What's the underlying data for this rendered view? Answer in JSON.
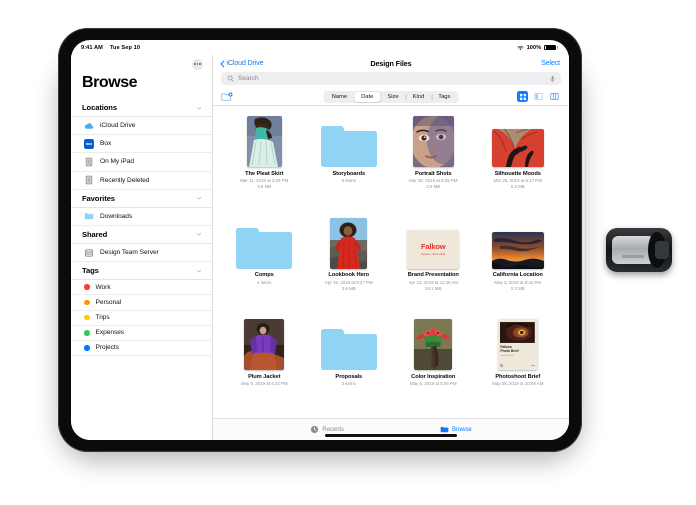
{
  "device": {
    "name": "ipad-pro",
    "accessory": "apple-pencil"
  },
  "status_bar": {
    "time": "9:41 AM",
    "date": "Tue Sep 10",
    "battery_percent": "100%",
    "wifi_icon": "wifi-icon",
    "battery_icon": "battery-full-icon"
  },
  "sidebar": {
    "title": "Browse",
    "more_button_icon": "more-ellipsis-icon",
    "sections": [
      {
        "title": "Locations",
        "chevron_icon": "chevron-down-icon",
        "items": [
          {
            "label": "iCloud Drive",
            "icon": "icloud-icon"
          },
          {
            "label": "Box",
            "icon": "box-app-icon",
            "glyph": "box"
          },
          {
            "label": "On My iPad",
            "icon": "ipad-icon"
          },
          {
            "label": "Recently Deleted",
            "icon": "trash-ipad-icon"
          }
        ]
      },
      {
        "title": "Favorites",
        "chevron_icon": "chevron-down-icon",
        "items": [
          {
            "label": "Downloads",
            "icon": "folder-icon"
          }
        ]
      },
      {
        "title": "Shared",
        "chevron_icon": "chevron-down-icon",
        "items": [
          {
            "label": "Design Team Server",
            "icon": "server-icon"
          }
        ]
      },
      {
        "title": "Tags",
        "chevron_icon": "chevron-down-icon",
        "items": [
          {
            "label": "Work",
            "icon": "tag-dot-icon",
            "color": "#ff3b30"
          },
          {
            "label": "Personal",
            "icon": "tag-dot-icon",
            "color": "#ff9500"
          },
          {
            "label": "Trips",
            "icon": "tag-dot-icon",
            "color": "#ffcc00"
          },
          {
            "label": "Expenses",
            "icon": "tag-dot-icon",
            "color": "#34c759"
          },
          {
            "label": "Projects",
            "icon": "tag-dot-icon",
            "color": "#007aff"
          }
        ]
      }
    ]
  },
  "navbar": {
    "back_label": "iCloud Drive",
    "back_icon": "chevron-left-icon",
    "title": "Design Files",
    "select_label": "Select"
  },
  "search": {
    "placeholder": "Search",
    "search_icon": "search-icon",
    "mic_icon": "microphone-icon"
  },
  "toolbar": {
    "new_folder_icon": "new-folder-icon",
    "sort_options": [
      "Name",
      "Date",
      "Size",
      "Kind",
      "Tags"
    ],
    "sort_selected": "Date",
    "view_modes": [
      {
        "icon": "grid-view-icon",
        "selected": true
      },
      {
        "icon": "list-view-icon",
        "selected": false
      },
      {
        "icon": "column-view-icon",
        "selected": false
      }
    ]
  },
  "files": [
    {
      "name": "The Pleat Skirt",
      "type": "image",
      "date": "Mar 11, 2019 at 3:28 PM",
      "size": "3.6 MB",
      "thumb": "photo-pleat-skirt"
    },
    {
      "name": "Storyboards",
      "type": "folder",
      "date": "",
      "size": "5 items",
      "thumb": "folder"
    },
    {
      "name": "Portrait Shots",
      "type": "image",
      "date": "Mar 28, 2019 at 5:25 PM",
      "size": "3.5 MB",
      "thumb": "photo-portrait"
    },
    {
      "name": "Silhouette Moods",
      "type": "image",
      "date": "Mar 28, 2019 at 6:17 PM",
      "size": "5.3 MB",
      "thumb": "photo-silhouette"
    },
    {
      "name": "Comps",
      "type": "folder",
      "date": "",
      "size": "4 items",
      "thumb": "folder"
    },
    {
      "name": "Lookbook Hero",
      "type": "image",
      "date": "Apr 19, 2019 at 9:37 PM",
      "size": "3.6 MB",
      "thumb": "photo-lookbook"
    },
    {
      "name": "Brand Presentation",
      "type": "doc",
      "date": "Apr 23, 2019 at 11:30 AM",
      "size": "54.1 MB",
      "thumb": "doc-falkow"
    },
    {
      "name": "California Location",
      "type": "image",
      "date": "May 3, 2019 at 8:42 PM",
      "size": "2.3 MB",
      "thumb": "photo-sunset"
    },
    {
      "name": "Plum Jacket",
      "type": "image",
      "date": "May 6, 2019 at 4:22 PM",
      "size": "",
      "thumb": "photo-plum"
    },
    {
      "name": "Proposals",
      "type": "folder",
      "date": "",
      "size": "3 items",
      "thumb": "folder"
    },
    {
      "name": "Color Inspiration",
      "type": "image",
      "date": "May 6, 2019 at 5:34 PM",
      "size": "",
      "thumb": "photo-watermelon"
    },
    {
      "name": "Photoshoot Brief",
      "type": "doc",
      "date": "May 28, 2019 at 10:08 AM",
      "size": "",
      "thumb": "doc-photo-brief"
    }
  ],
  "doc_thumbs": {
    "falkow_title": "Falkow",
    "falkow_sub": "Season / Show 2019",
    "brief_line1": "Falkow",
    "brief_line2": "Photo Brief",
    "brief_sub": "Lookbook SS19"
  },
  "tabbar": {
    "items": [
      {
        "label": "Recents",
        "icon": "clock-icon",
        "active": false
      },
      {
        "label": "Browse",
        "icon": "folder-icon",
        "active": true
      }
    ]
  },
  "colors": {
    "accent": "#0a7cff",
    "folder": "#8fd3f5",
    "muted": "#97979b"
  }
}
